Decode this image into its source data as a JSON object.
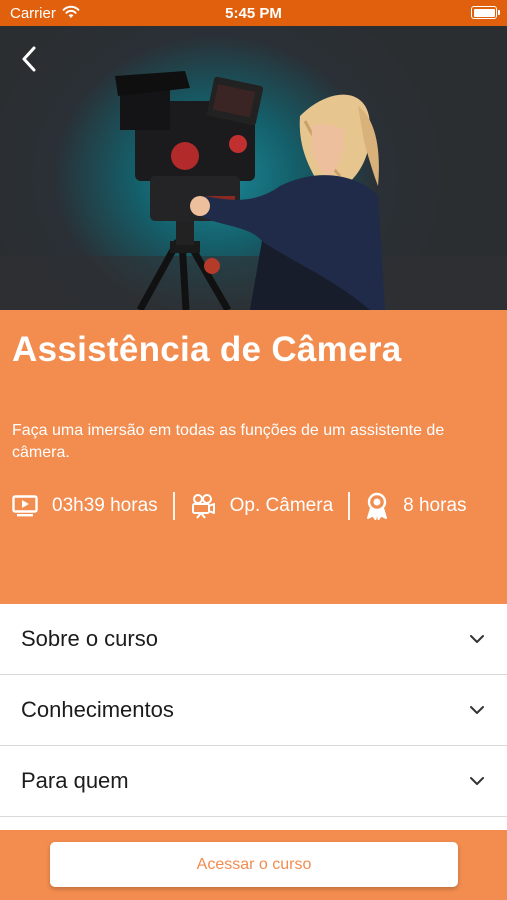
{
  "status_bar": {
    "carrier": "Carrier",
    "time": "5:45 PM"
  },
  "course": {
    "title": "Assistência de Câmera",
    "description": "Faça uma imersão em todas as funções de um assistente de câmera.",
    "meta": [
      {
        "icon": "video-icon",
        "text": "03h39 horas"
      },
      {
        "icon": "film-camera-icon",
        "text": "Op. Câmera"
      },
      {
        "icon": "certificate-award-icon",
        "text": "8 horas"
      }
    ]
  },
  "sections": [
    {
      "label": "Sobre o curso"
    },
    {
      "label": "Conhecimentos"
    },
    {
      "label": "Para quem"
    }
  ],
  "cta": {
    "label": "Acessar o curso"
  },
  "colors": {
    "status_bar": "#e0600d",
    "accent": "#f28c4f",
    "text_dark": "#1c1c1c"
  }
}
